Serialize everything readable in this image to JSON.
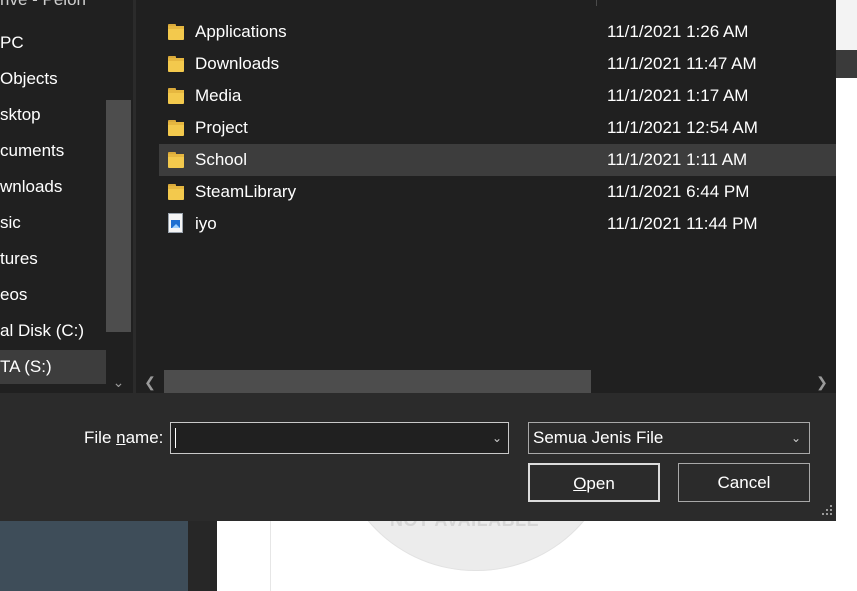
{
  "nav": {
    "top_fragment": "rive - Pelon",
    "items": [
      {
        "label": "PC",
        "selected": false
      },
      {
        "label": "Objects",
        "selected": false
      },
      {
        "label": "sktop",
        "selected": false
      },
      {
        "label": "cuments",
        "selected": false
      },
      {
        "label": "wnloads",
        "selected": false
      },
      {
        "label": "sic",
        "selected": false
      },
      {
        "label": "tures",
        "selected": false
      },
      {
        "label": "eos",
        "selected": false
      },
      {
        "label": "al Disk (C:)",
        "selected": false
      },
      {
        "label": "TA (S:)",
        "selected": true
      }
    ]
  },
  "files": [
    {
      "name": "Applications",
      "date": "11/1/2021 1:26 AM",
      "icon": "folder-icon",
      "selected": false
    },
    {
      "name": "Downloads",
      "date": "11/1/2021 11:47 AM",
      "icon": "folder-icon",
      "selected": false
    },
    {
      "name": "Media",
      "date": "11/1/2021 1:17 AM",
      "icon": "folder-icon",
      "selected": false
    },
    {
      "name": "Project",
      "date": "11/1/2021 12:54 AM",
      "icon": "folder-icon",
      "selected": false
    },
    {
      "name": "School",
      "date": "11/1/2021 1:11 AM",
      "icon": "folder-icon",
      "selected": true
    },
    {
      "name": "SteamLibrary",
      "date": "11/1/2021 6:44 PM",
      "icon": "folder-icon",
      "selected": false
    },
    {
      "name": "iyo",
      "date": "11/1/2021 11:44 PM",
      "icon": "image-file-icon",
      "selected": false
    }
  ],
  "bottom": {
    "filename_label_pre": "File ",
    "filename_label_accel": "n",
    "filename_label_post": "ame:",
    "filename_value": "",
    "filetype_value": "Semua Jenis File",
    "open_accel": "O",
    "open_rest": "pen",
    "cancel_label": "Cancel"
  },
  "background": {
    "not_available_text": "NOT AVAILABLE"
  },
  "colors": {
    "dialog_bg": "#2b2b2b",
    "pane_bg": "#202020",
    "selection_bg": "#3d3d3d",
    "folder_yellow": "#f3c94d"
  }
}
